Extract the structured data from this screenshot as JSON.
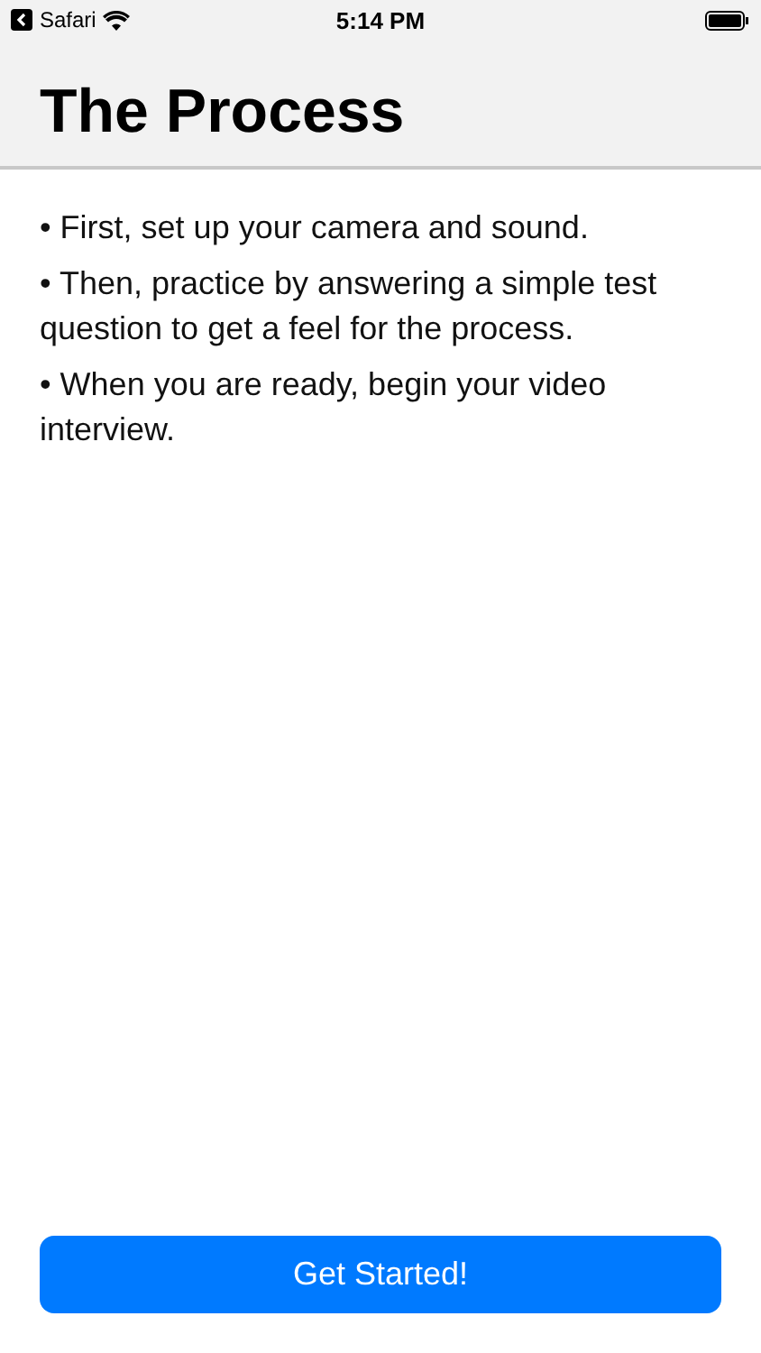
{
  "status_bar": {
    "back_app": "Safari",
    "time": "5:14 PM"
  },
  "header": {
    "title": "The Process"
  },
  "steps": [
    "• First, set up your camera and sound.",
    "• Then, practice by answering a simple test question to get a feel for the process.",
    "• When you are ready, begin your video interview."
  ],
  "button": {
    "label": "Get Started!"
  }
}
